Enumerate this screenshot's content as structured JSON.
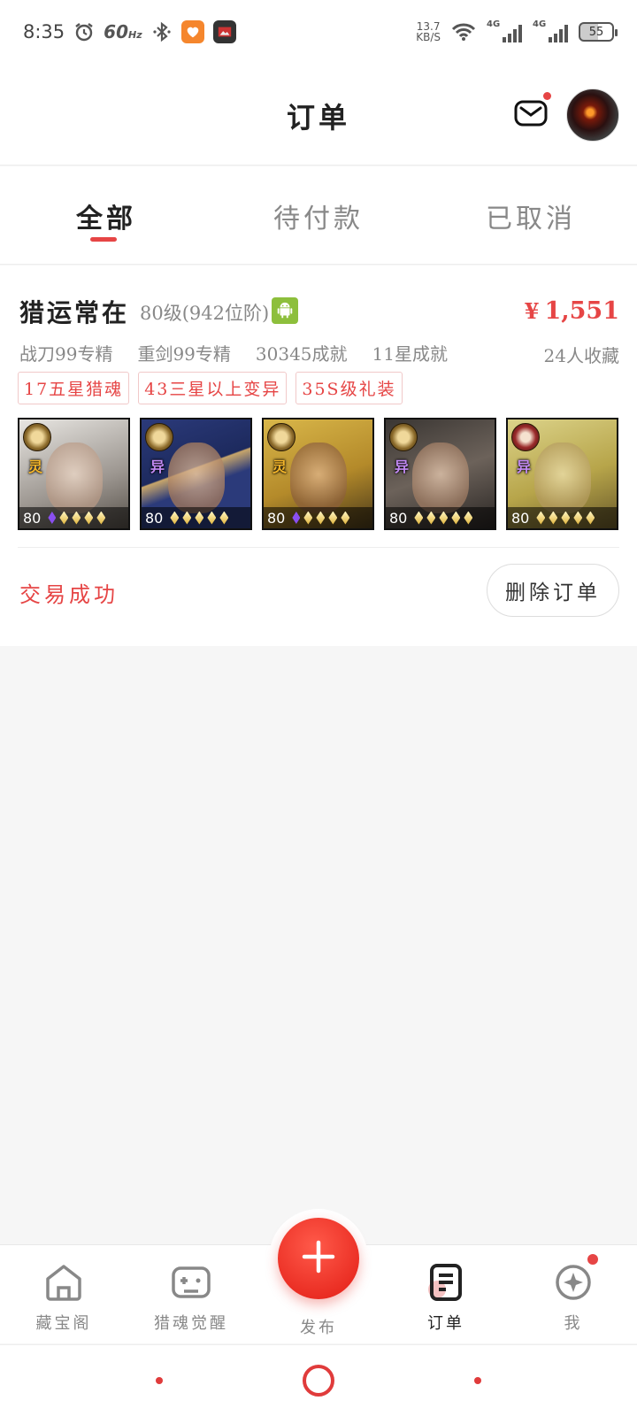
{
  "status_bar": {
    "time": "8:35",
    "refresh_rate": "60",
    "refresh_unit": "Hz",
    "net_speed_value": "13.7",
    "net_speed_unit": "KB/S",
    "network_1": "4G",
    "network_2": "4G",
    "battery": "55"
  },
  "header": {
    "title": "订单"
  },
  "tabs": [
    {
      "label": "全部",
      "active": true
    },
    {
      "label": "待付款",
      "active": false
    },
    {
      "label": "已取消",
      "active": false
    }
  ],
  "order": {
    "account_name": "猎运常在",
    "level": "80级(942位阶)",
    "price_currency": "¥",
    "price": "1,551",
    "attributes": [
      "战刀99专精",
      "重剑99专精",
      "30345成就",
      "11星成就"
    ],
    "favorites": "24人收藏",
    "tags": [
      "17五星猎魂",
      "43三星以上变异",
      "35S级礼装"
    ],
    "heroes": [
      {
        "level": "80",
        "type": "灵",
        "gem": true,
        "stars": 4
      },
      {
        "level": "80",
        "type": "异",
        "gem": false,
        "stars": 5
      },
      {
        "level": "80",
        "type": "灵",
        "gem": true,
        "stars": 4
      },
      {
        "level": "80",
        "type": "异",
        "gem": false,
        "stars": 5
      },
      {
        "level": "80",
        "type": "异",
        "gem": false,
        "stars": 5
      }
    ],
    "status": "交易成功",
    "delete_label": "删除订单"
  },
  "bottom_nav": {
    "items": [
      {
        "label": "藏宝阁",
        "icon": "home-icon"
      },
      {
        "label": "猎魂觉醒",
        "icon": "gamepad-icon"
      },
      {
        "label": "订单",
        "icon": "order-icon",
        "active": true
      },
      {
        "label": "我",
        "icon": "compass-icon"
      }
    ],
    "publish_label": "发布"
  },
  "colors": {
    "accent": "#e64545",
    "android_badge": "#8dbf3c"
  }
}
